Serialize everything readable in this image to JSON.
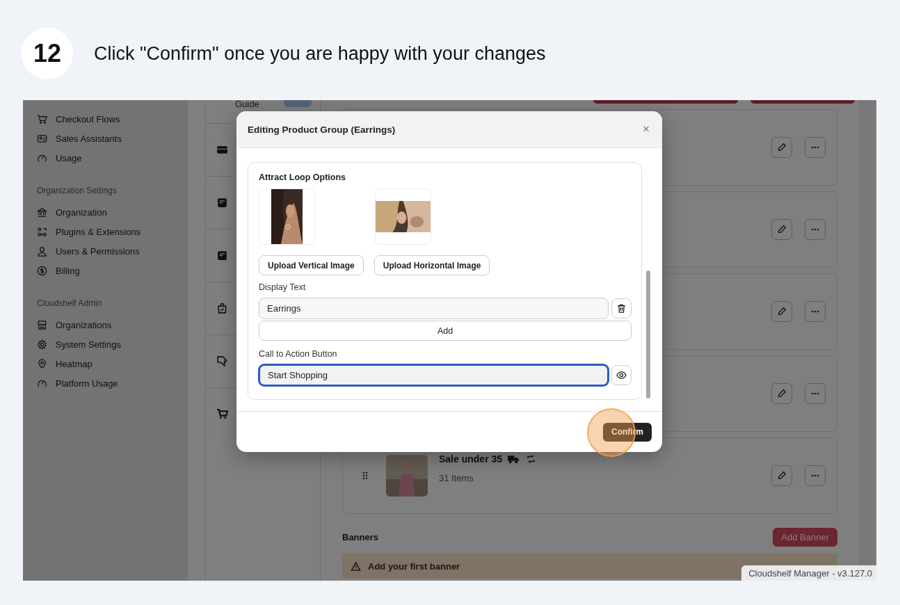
{
  "step": {
    "number": "12",
    "instruction": "Click \"Confirm\" once you are happy with your changes"
  },
  "sidebar": {
    "sections": [
      {
        "items": [
          "Checkout Flows",
          "Sales Assistants",
          "Usage"
        ]
      },
      {
        "title": "Organization Settings",
        "items": [
          "Organization",
          "Plugins & Extensions",
          "Users & Permissions",
          "Billing"
        ]
      },
      {
        "title": "Cloudshelf Admin",
        "items": [
          "Organizations",
          "System Settings",
          "Heatmap",
          "Platform Usage"
        ]
      }
    ]
  },
  "middle_column": {
    "guide_label": "Guide"
  },
  "product_groups": [
    {
      "kind": "hidden"
    },
    {
      "kind": "hidden"
    },
    {
      "kind": "hidden"
    },
    {
      "kind": "hidden"
    },
    {
      "kind": "product",
      "title": "Sale under 35",
      "count": "31 Items"
    }
  ],
  "banners": {
    "title": "Banners",
    "add_button": "Add Banner",
    "notice": "Add your first banner"
  },
  "version": "Cloudshelf Manager - v3.127.0",
  "modal": {
    "title": "Editing Product Group (Earrings)",
    "close": "×",
    "section_title": "Attract Loop Options",
    "upload_buttons": [
      "Upload Vertical Image",
      "Upload Horizontal Image"
    ],
    "display_text_label": "Display Text",
    "display_texts": [
      "Earrings"
    ],
    "add_button": "Add",
    "cta_label": "Call to Action Button",
    "cta_value": "Start Shopping",
    "cta_focused": true,
    "confirm_button": "Confirm"
  }
}
